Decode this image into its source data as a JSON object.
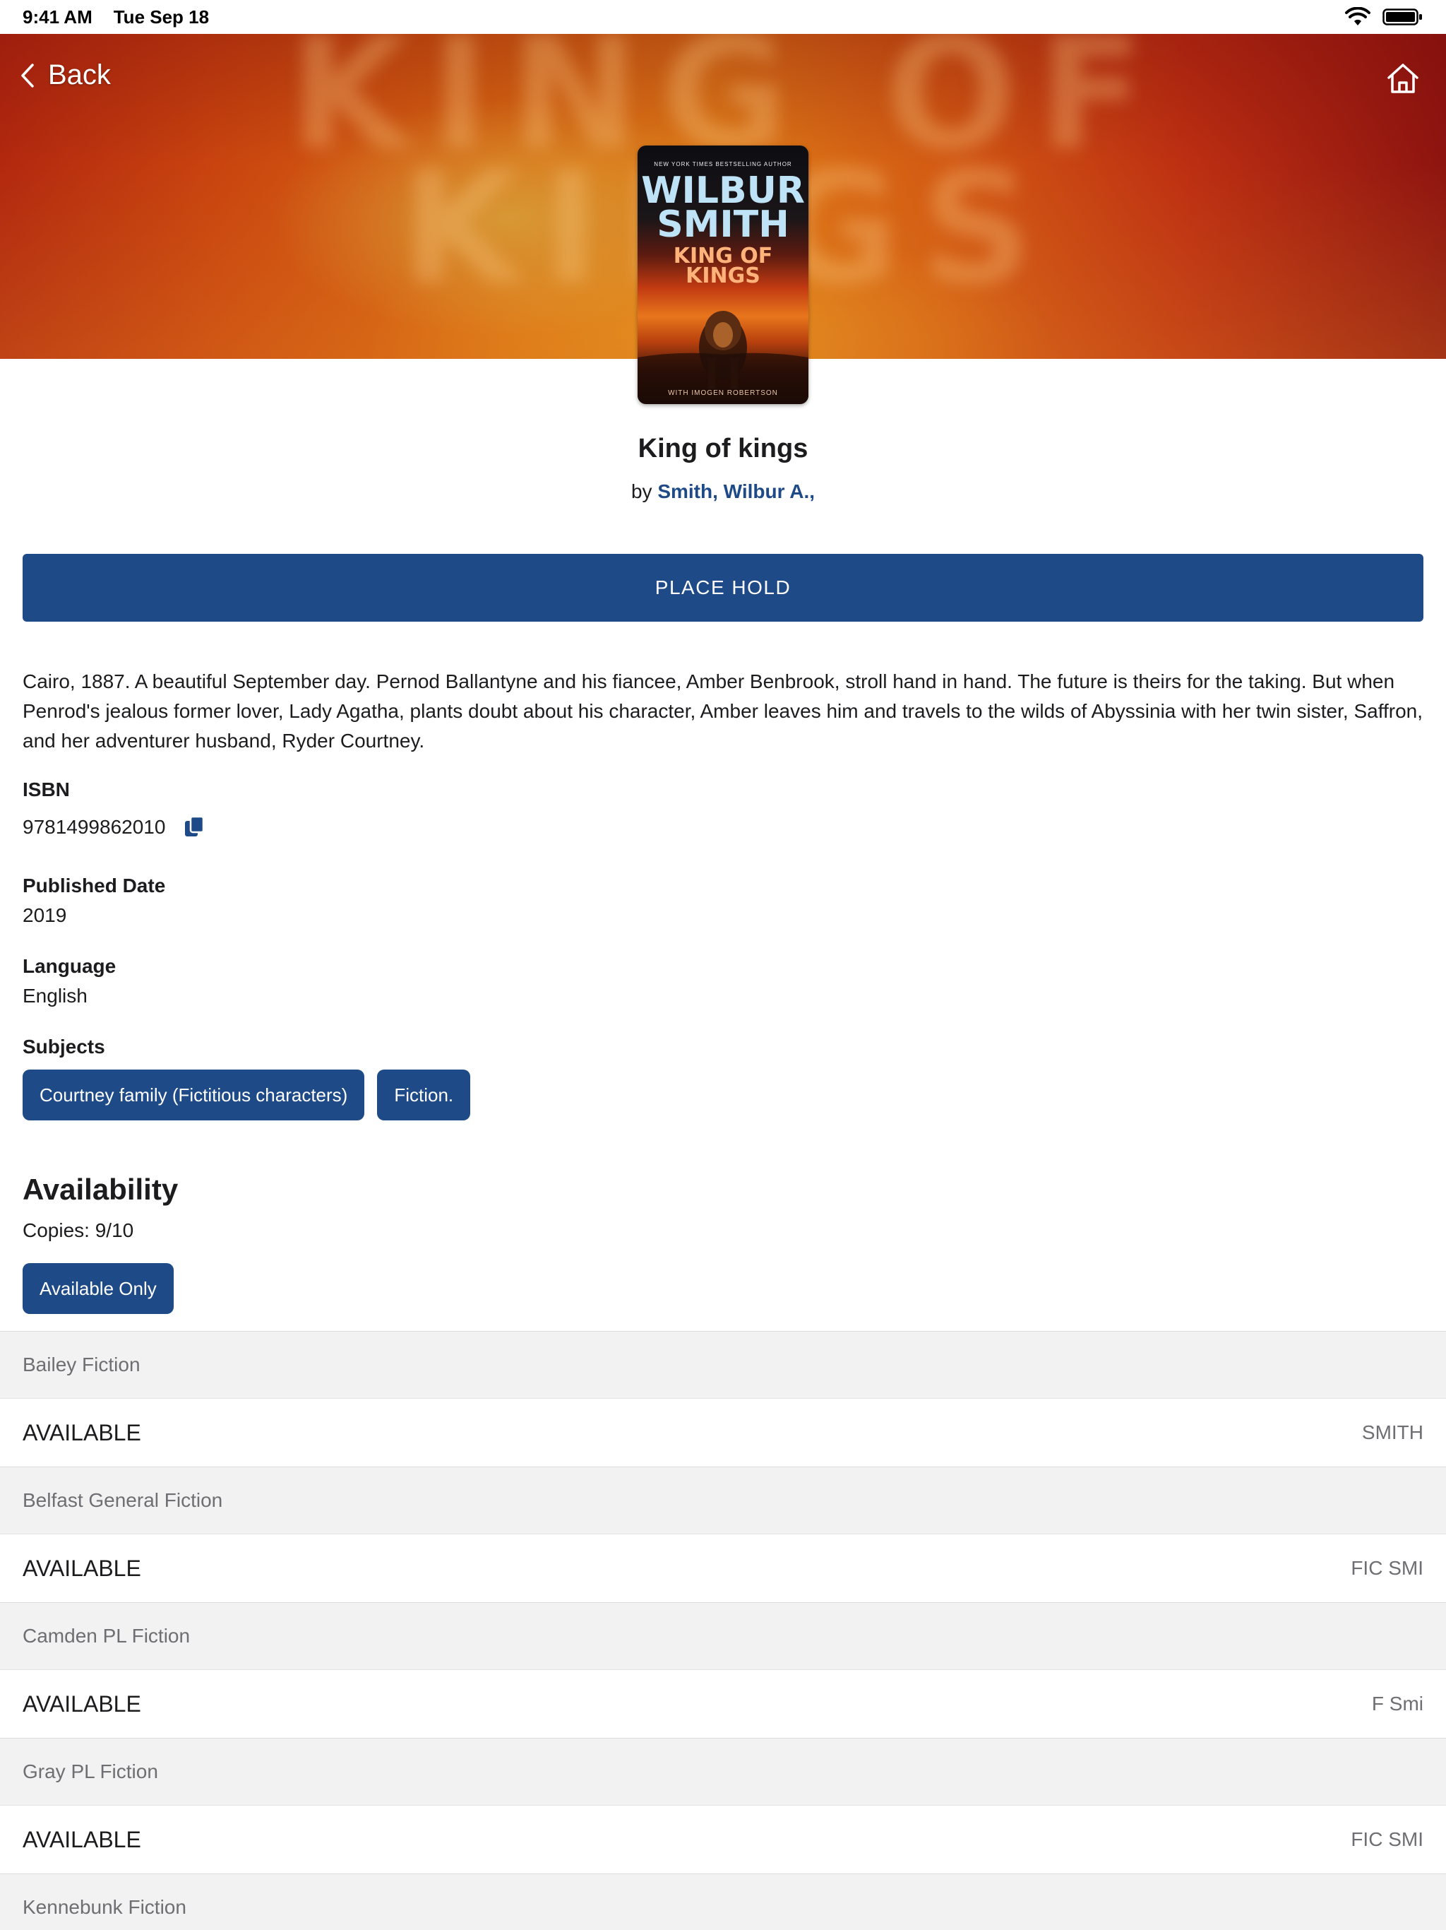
{
  "status_bar": {
    "time": "9:41 AM",
    "date": "Tue Sep 18",
    "icons": [
      "wifi-icon",
      "battery-icon"
    ]
  },
  "nav": {
    "back_label": "Back",
    "back_icon": "chevron-left-icon",
    "home_icon": "home-icon"
  },
  "hero": {
    "ghost_text_line1": "KING OF",
    "ghost_text_line2": "KINGS"
  },
  "cover": {
    "tagline": "NEW YORK TIMES BESTSELLING AUTHOR",
    "author_line1": "WILBUR",
    "author_line2": "SMITH",
    "title_line1": "KING OF",
    "title_line2": "KINGS",
    "byline": "WITH IMOGEN ROBERTSON"
  },
  "book": {
    "title": "King of kings",
    "by_prefix": "by",
    "author": "Smith, Wilbur A.,"
  },
  "actions": {
    "place_hold_label": "PLACE HOLD"
  },
  "description": "Cairo, 1887. A beautiful September day. Pernod Ballantyne and his fiancee, Amber Benbrook, stroll hand in hand. The future is theirs for the taking. But when Penrod's jealous former lover, Lady Agatha, plants doubt about his character, Amber leaves him and travels to the wilds of Abyssinia with her twin sister, Saffron, and her adventurer husband, Ryder Courtney.",
  "details": {
    "isbn_label": "ISBN",
    "isbn_value": "9781499862010",
    "published_label": "Published Date",
    "published_value": "2019",
    "language_label": "Language",
    "language_value": "English",
    "subjects_label": "Subjects",
    "subjects": [
      "Courtney family (Fictitious characters)",
      "Fiction."
    ]
  },
  "availability": {
    "heading": "Availability",
    "copies": "Copies: 9/10",
    "filter_label": "Available Only",
    "holdings": [
      {
        "location": "Bailey Fiction",
        "status": "AVAILABLE",
        "call_number": "SMITH"
      },
      {
        "location": "Belfast General Fiction",
        "status": "AVAILABLE",
        "call_number": "FIC SMI"
      },
      {
        "location": "Camden PL Fiction",
        "status": "AVAILABLE",
        "call_number": "F Smi"
      },
      {
        "location": "Gray PL Fiction",
        "status": "AVAILABLE",
        "call_number": "FIC SMI"
      },
      {
        "location": "Kennebunk Fiction"
      }
    ]
  },
  "colors": {
    "accent": "#1e4a87",
    "row_alt": "#f2f2f2",
    "muted_text": "#6e6e73"
  }
}
